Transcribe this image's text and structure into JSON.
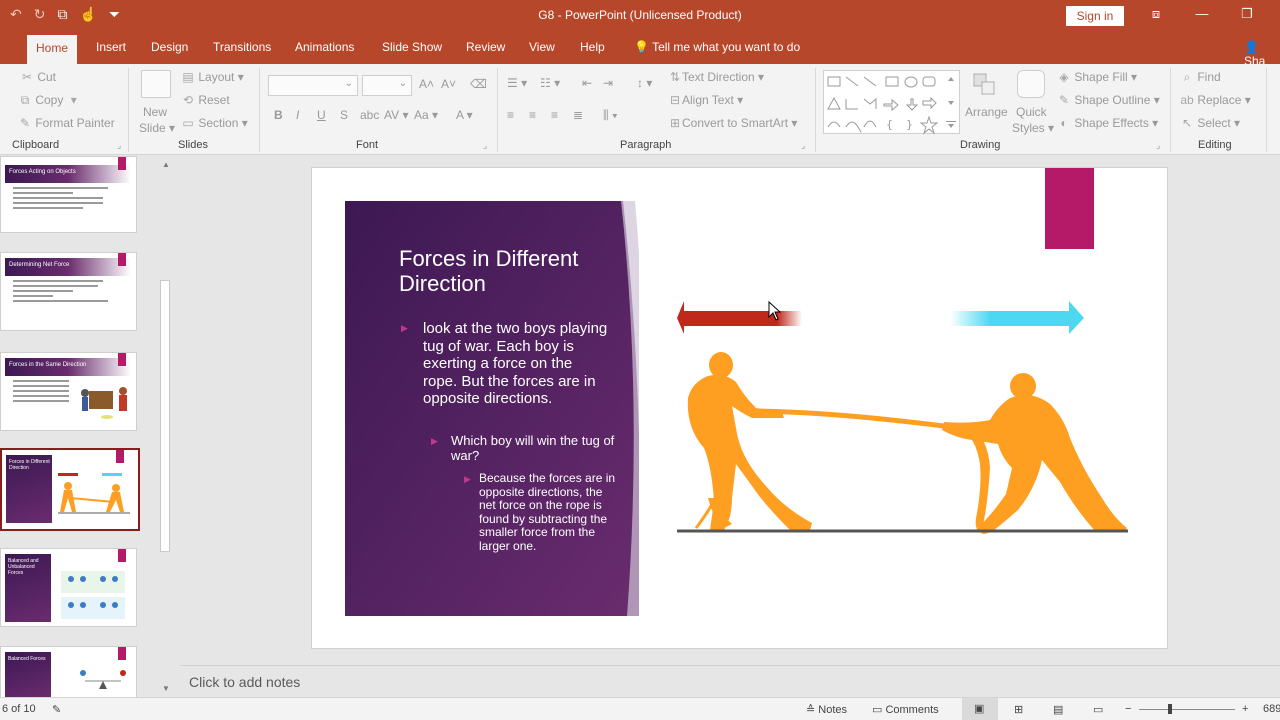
{
  "app": {
    "title": "G8  -  PowerPoint (Unlicensed Product)",
    "sign_in": "Sign in",
    "theme_color": "#b7472a",
    "quick_access_icons": [
      "undo-icon",
      "redo-icon",
      "present-icon",
      "touch-mode-icon",
      "customize-icon"
    ]
  },
  "tabs": {
    "items": [
      "Home",
      "Insert",
      "Design",
      "Transitions",
      "Animations",
      "Slide Show",
      "Review",
      "View",
      "Help"
    ],
    "active": "Home",
    "tell_me": "Tell me what you want to do",
    "share": "Sha"
  },
  "ribbon": {
    "clipboard": {
      "label": "Clipboard",
      "cut": "Cut",
      "copy": "Copy",
      "format_painter": "Format Painter"
    },
    "slides": {
      "label": "Slides",
      "new_slide_1": "New",
      "new_slide_2": "Slide",
      "layout": "Layout",
      "reset": "Reset",
      "section": "Section"
    },
    "font": {
      "label": "Font",
      "bold": "B",
      "italic": "I",
      "underline": "U",
      "strike": "S",
      "font_color": "A"
    },
    "paragraph": {
      "label": "Paragraph",
      "text_direction": "Text Direction",
      "align_text": "Align Text",
      "convert_smartart": "Convert to SmartArt"
    },
    "drawing": {
      "label": "Drawing",
      "arrange": "Arrange",
      "quick_styles_1": "Quick",
      "quick_styles_2": "Styles",
      "shape_fill": "Shape Fill",
      "shape_outline": "Shape Outline",
      "shape_effects": "Shape Effects"
    },
    "editing": {
      "label": "Editing",
      "find": "Find",
      "replace": "Replace",
      "select": "Select"
    }
  },
  "thumbnails": [
    {
      "title": "Forces Acting on Objects",
      "selected": false
    },
    {
      "title": "Determining Net Force",
      "selected": false
    },
    {
      "title": "Forces in the Same Direction",
      "selected": false
    },
    {
      "title": "Forces in Different Direction",
      "selected": true
    },
    {
      "title": "Balanced and Unbalanced Forces",
      "selected": false
    },
    {
      "title": "Balanced Forces",
      "selected": false
    }
  ],
  "slide": {
    "title": "Forces in Different Direction",
    "bullet1": "look at the two boys playing tug of war. Each boy is exerting a force on the rope. But the forces are in opposite directions.",
    "bullet2": "Which boy will win the tug of war?",
    "bullet3": "Because the forces are in opposite directions, the net force on the rope is found by subtracting the smaller force from the larger one.",
    "colors": {
      "panel_dark": "#3c1853",
      "panel_mid": "#6a2c6e",
      "accent": "#b51a69",
      "left_arrow": "#c0281c",
      "right_arrow": "#4dd8f2",
      "figures": "#ff9f22"
    }
  },
  "notes": {
    "placeholder": "Click to add notes"
  },
  "status": {
    "slide_counter": "6 of 10",
    "notes": "Notes",
    "comments": "Comments",
    "zoom": "689",
    "zoom_minus": "−",
    "zoom_plus": "+"
  }
}
